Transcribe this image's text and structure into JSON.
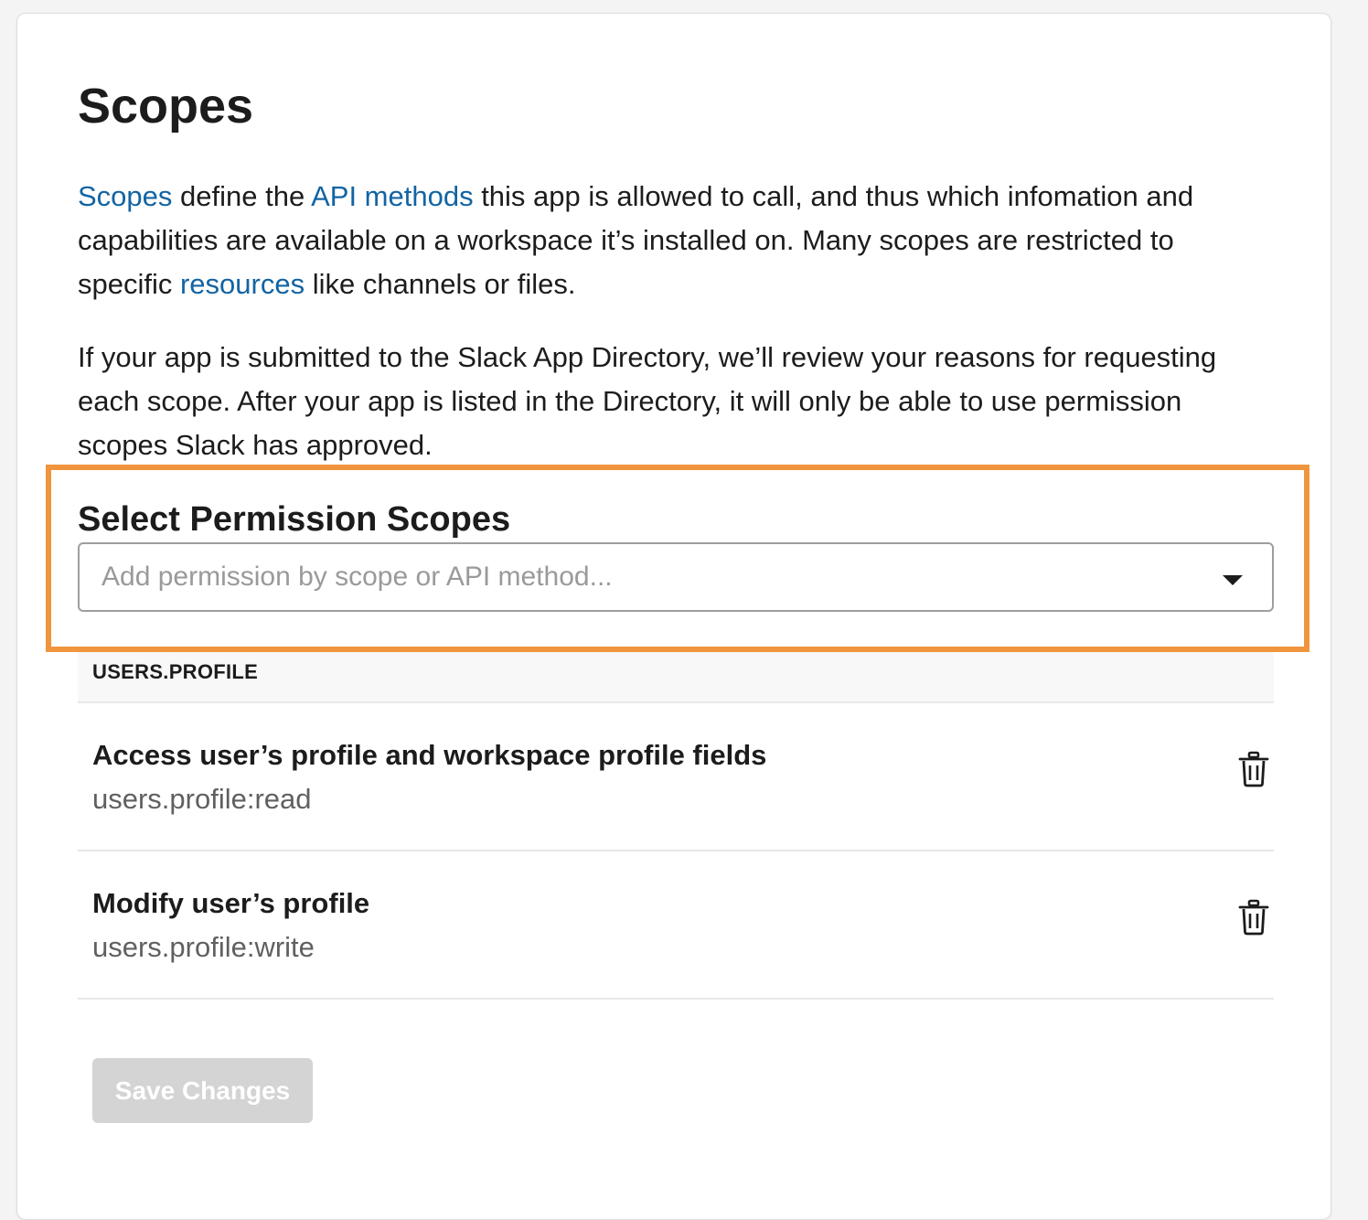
{
  "page": {
    "title": "Scopes"
  },
  "intro": {
    "link_scopes": "Scopes",
    "text_1": " define the ",
    "link_api_methods": "API methods",
    "text_2": " this app is allowed to call, and thus which infomation and capabilities are available on a workspace it’s installed on. Many scopes are restricted to specific ",
    "link_resources": "resources",
    "text_3": " like channels or files."
  },
  "review_note": "If your app is submitted to the Slack App Directory, we’ll review your reasons for requesting each scope. After your app is listed in the Directory, it will only be able to use permission scopes Slack has approved.",
  "select": {
    "heading": "Select Permission Scopes",
    "placeholder": "Add permission by scope or API method...",
    "chevron_icon": "chevron-down-icon"
  },
  "scope_group": {
    "label": "USERS.PROFILE",
    "items": [
      {
        "title": "Access user’s profile and workspace profile fields",
        "scope": "users.profile:read",
        "icon": "trash-icon"
      },
      {
        "title": "Modify user’s profile",
        "scope": "users.profile:write",
        "icon": "trash-icon"
      }
    ]
  },
  "actions": {
    "save_label": "Save Changes"
  },
  "colors": {
    "link": "#1264a3",
    "highlight_border": "#f0953d",
    "disabled_button": "#d4d4d4"
  }
}
